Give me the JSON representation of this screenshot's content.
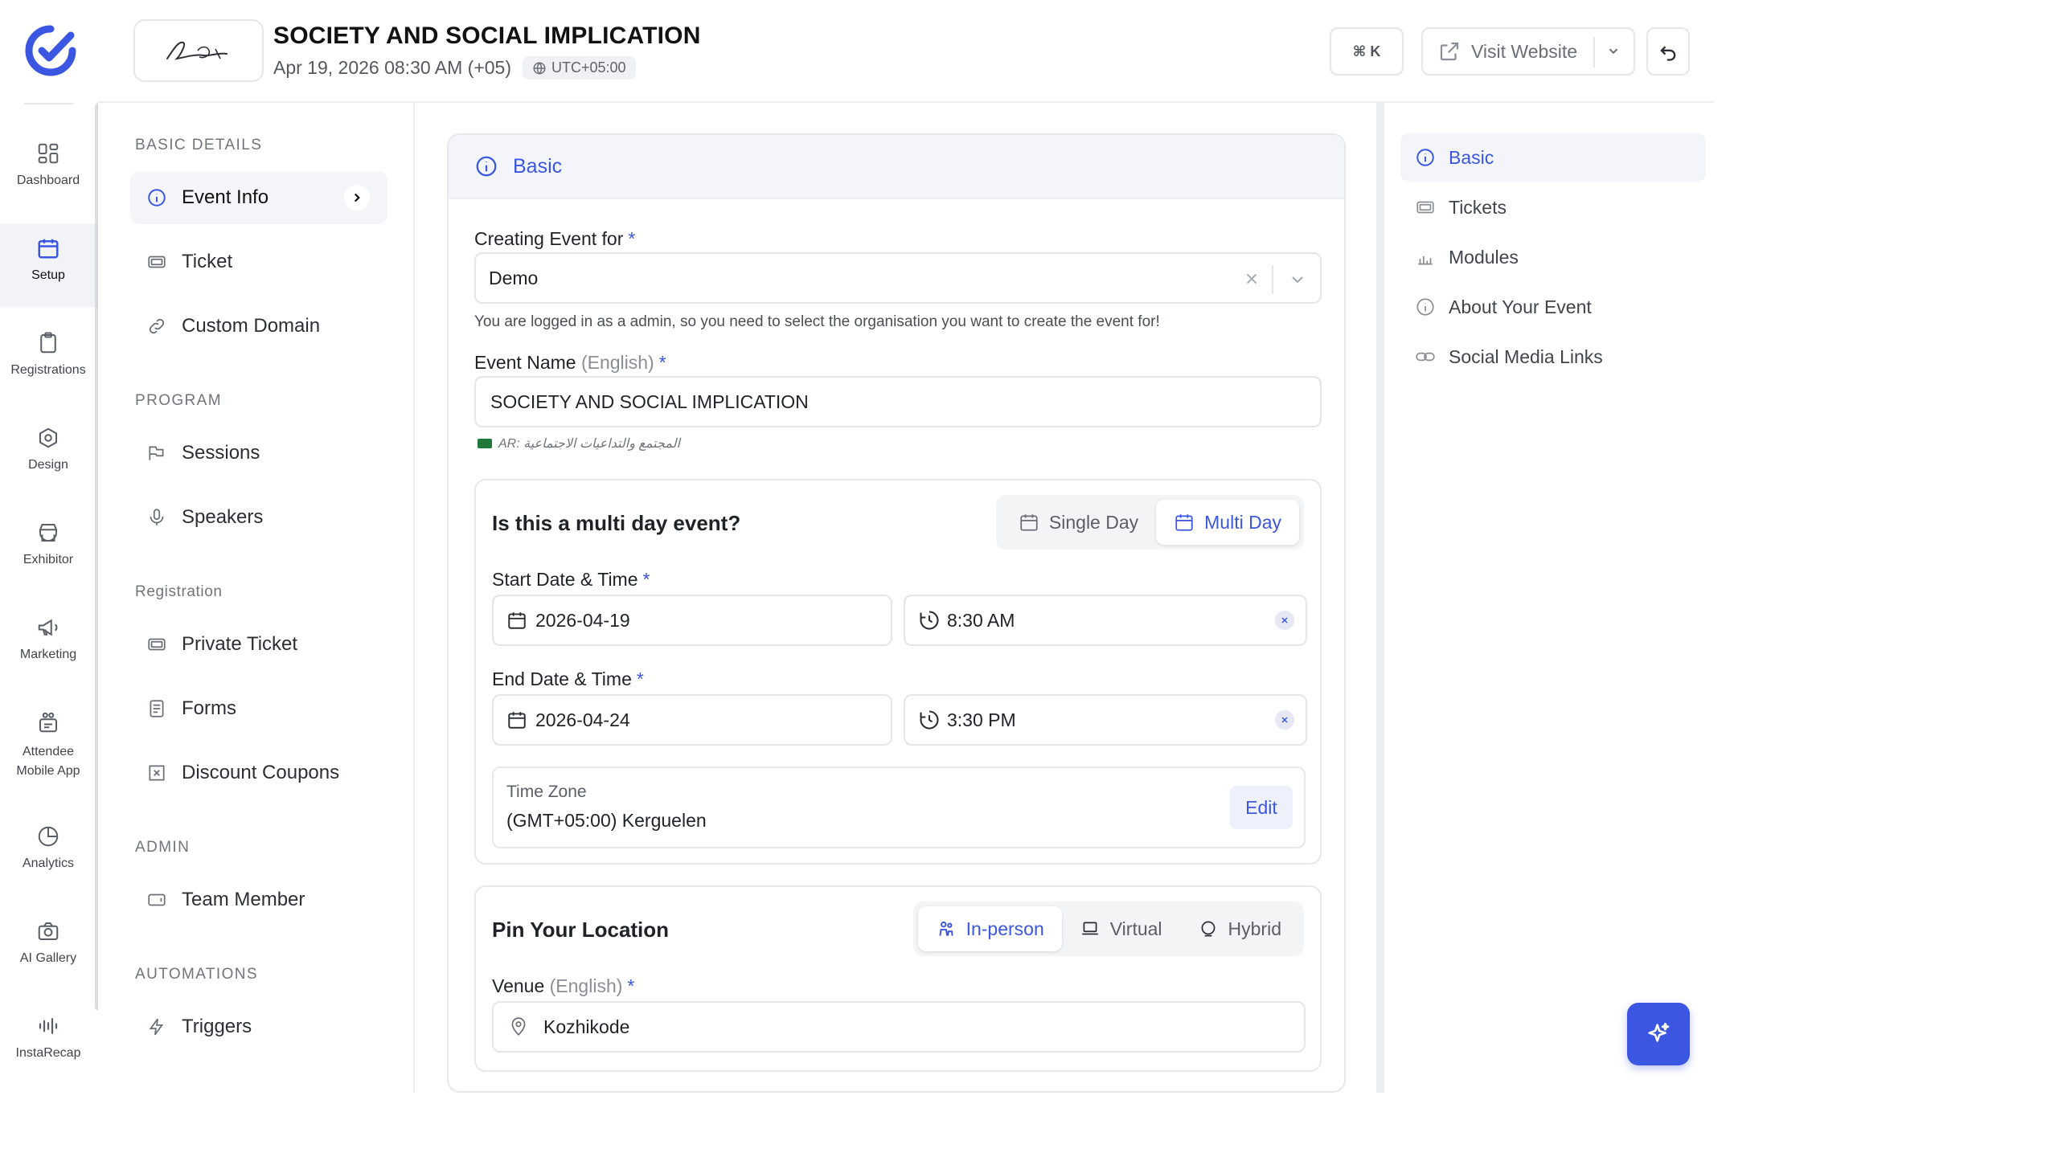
{
  "rail": {
    "items": [
      {
        "label": "Dashboard"
      },
      {
        "label": "Setup"
      },
      {
        "label": "Registrations"
      },
      {
        "label": "Design"
      },
      {
        "label": "Exhibitor"
      },
      {
        "label": "Marketing"
      },
      {
        "label": "Attendee Mobile App"
      },
      {
        "label": "Analytics"
      },
      {
        "label": "AI Gallery"
      },
      {
        "label": "InstaRecap"
      }
    ],
    "active": "Setup"
  },
  "header": {
    "title": "SOCIETY AND SOCIAL IMPLICATION",
    "date": "Apr 19, 2026 08:30 AM (+05)",
    "tz_pill": "UTC+05:00",
    "shortcut": "⌘ K",
    "visit_label": "Visit Website"
  },
  "sections": {
    "basic_heading": "BASIC DETAILS",
    "basic_items": [
      "Event Info",
      "Ticket",
      "Custom Domain"
    ],
    "program_heading": "PROGRAM",
    "program_items": [
      "Sessions",
      "Speakers"
    ],
    "registration_heading": "Registration",
    "registration_items": [
      "Private Ticket",
      "Forms",
      "Discount Coupons"
    ],
    "admin_heading": "ADMIN",
    "admin_items": [
      "Team Member"
    ],
    "automations_heading": "AUTOMATIONS",
    "automations_items": [
      "Triggers"
    ],
    "active": "Event Info"
  },
  "form": {
    "card_title": "Basic",
    "creating_for_label": "Creating Event for",
    "creating_for_value": "Demo",
    "creating_for_hint": "You are logged in as a admin, so you need to select the organisation you want to create the event for!",
    "event_name_label": "Event Name",
    "event_name_lang": "(English)",
    "event_name_value": "SOCIETY AND SOCIAL IMPLICATION",
    "ar_note": "AR: المجتمع والتداعيات الاجتماعية",
    "required_mark": "*",
    "multi_day_question": "Is this a multi day event?",
    "single_day_label": "Single Day",
    "multi_day_label": "Multi Day",
    "day_mode": "Multi Day",
    "start_label": "Start Date & Time",
    "start_date": "2026-04-19",
    "start_time": "8:30 AM",
    "end_label": "End Date & Time",
    "end_date": "2026-04-24",
    "end_time": "3:30 PM",
    "tz_label": "Time Zone",
    "tz_value": "(GMT+05:00) Kerguelen",
    "tz_edit": "Edit",
    "location_title": "Pin Your Location",
    "loc_modes": [
      "In-person",
      "Virtual",
      "Hybrid"
    ],
    "loc_active": "In-person",
    "venue_label": "Venue",
    "venue_lang": "(English)",
    "venue_value": "Kozhikode"
  },
  "anchors": {
    "items": [
      "Basic",
      "Tickets",
      "Modules",
      "About Your Event",
      "Social Media Links"
    ],
    "active": "Basic"
  },
  "colors": {
    "accent": "#3b56e0",
    "accent_bg": "#f3f5fb",
    "border": "#e4e6ea"
  }
}
